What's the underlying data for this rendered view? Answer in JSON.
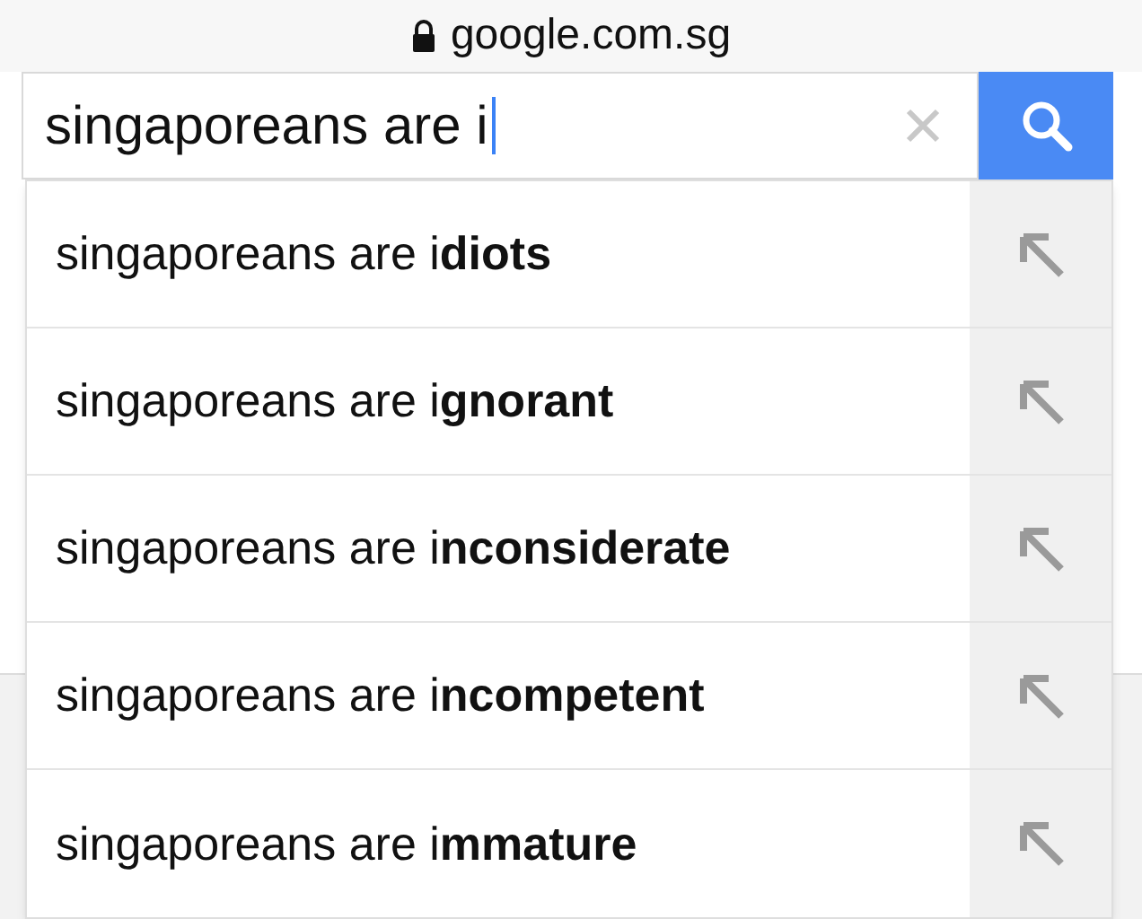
{
  "address_bar": {
    "url": "google.com.sg",
    "secure": true
  },
  "search": {
    "value": "singaporeans are i"
  },
  "suggestions": [
    {
      "text": "singaporeans are i**diots**"
    },
    {
      "text": "singaporeans are i**gnorant**"
    },
    {
      "text": "singaporeans are i**nconsiderate**"
    },
    {
      "text": "singaporeans are i**ncompetent**"
    },
    {
      "text": "singaporeans are i**mmature**"
    }
  ]
}
